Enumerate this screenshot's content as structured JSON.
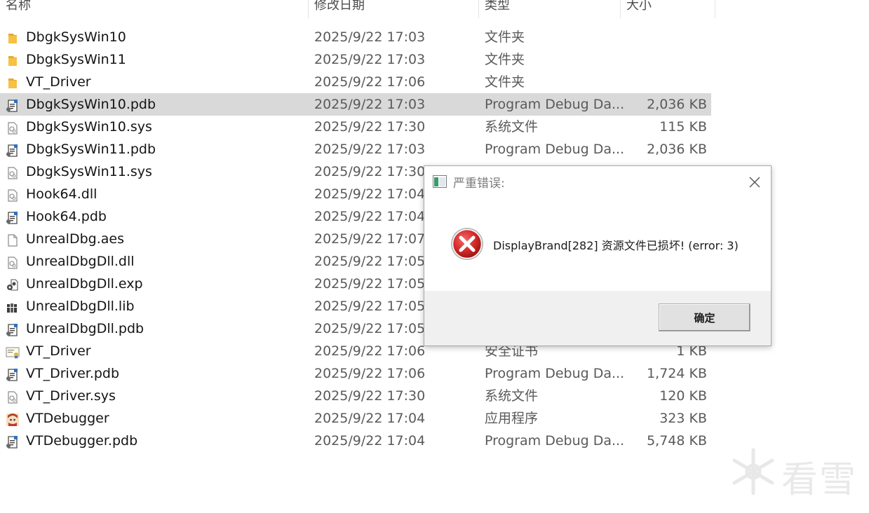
{
  "columns": {
    "name": "名称",
    "date": "修改日期",
    "type": "类型",
    "size": "大小"
  },
  "files": [
    {
      "name": "DbgkSysWin10",
      "date": "2025/9/22 17:03",
      "type": "文件夹",
      "size": "",
      "icon": "folder-icon",
      "selected": false
    },
    {
      "name": "DbgkSysWin11",
      "date": "2025/9/22 17:03",
      "type": "文件夹",
      "size": "",
      "icon": "folder-icon",
      "selected": false
    },
    {
      "name": "VT_Driver",
      "date": "2025/9/22 17:06",
      "type": "文件夹",
      "size": "",
      "icon": "folder-icon",
      "selected": false
    },
    {
      "name": "DbgkSysWin10.pdb",
      "date": "2025/9/22 17:03",
      "type": "Program Debug Da...",
      "size": "2,036 KB",
      "icon": "pdb-file-icon",
      "selected": true
    },
    {
      "name": "DbgkSysWin10.sys",
      "date": "2025/9/22 17:30",
      "type": "系统文件",
      "size": "115 KB",
      "icon": "system-file-icon",
      "selected": false
    },
    {
      "name": "DbgkSysWin11.pdb",
      "date": "2025/9/22 17:03",
      "type": "Program Debug Da...",
      "size": "2,036 KB",
      "icon": "pdb-file-icon",
      "selected": false
    },
    {
      "name": "DbgkSysWin11.sys",
      "date": "2025/9/22 17:30",
      "type": "",
      "size": "",
      "icon": "system-file-icon",
      "selected": false
    },
    {
      "name": "Hook64.dll",
      "date": "2025/9/22 17:04",
      "type": "",
      "size": "",
      "icon": "system-file-icon",
      "selected": false
    },
    {
      "name": "Hook64.pdb",
      "date": "2025/9/22 17:04",
      "type": "",
      "size": "",
      "icon": "pdb-file-icon",
      "selected": false
    },
    {
      "name": "UnrealDbg.aes",
      "date": "2025/9/22 17:07",
      "type": "",
      "size": "",
      "icon": "blank-file-icon",
      "selected": false
    },
    {
      "name": "UnrealDbgDll.dll",
      "date": "2025/9/22 17:05",
      "type": "",
      "size": "",
      "icon": "system-file-icon",
      "selected": false
    },
    {
      "name": "UnrealDbgDll.exp",
      "date": "2025/9/22 17:05",
      "type": "",
      "size": "",
      "icon": "gear-file-icon",
      "selected": false
    },
    {
      "name": "UnrealDbgDll.lib",
      "date": "2025/9/22 17:05",
      "type": "",
      "size": "",
      "icon": "library-file-icon",
      "selected": false
    },
    {
      "name": "UnrealDbgDll.pdb",
      "date": "2025/9/22 17:05",
      "type": "",
      "size": "",
      "icon": "pdb-file-icon",
      "selected": false
    },
    {
      "name": "VT_Driver",
      "date": "2025/9/22 17:06",
      "type": "安全证书",
      "size": "1 KB",
      "icon": "certificate-icon",
      "selected": false
    },
    {
      "name": "VT_Driver.pdb",
      "date": "2025/9/22 17:06",
      "type": "Program Debug Da...",
      "size": "1,724 KB",
      "icon": "pdb-file-icon",
      "selected": false
    },
    {
      "name": "VT_Driver.sys",
      "date": "2025/9/22 17:30",
      "type": "系统文件",
      "size": "120 KB",
      "icon": "system-file-icon",
      "selected": false
    },
    {
      "name": "VTDebugger",
      "date": "2025/9/22 17:04",
      "type": "应用程序",
      "size": "323 KB",
      "icon": "app-icon",
      "selected": false
    },
    {
      "name": "VTDebugger.pdb",
      "date": "2025/9/22 17:04",
      "type": "Program Debug Da...",
      "size": "5,748 KB",
      "icon": "pdb-file-icon",
      "selected": false
    }
  ],
  "dialog": {
    "title": "严重错误:",
    "message": "DisplayBrand[282] 资源文件已损坏! (error: 3)",
    "ok_label": "确定",
    "icon": "error-icon"
  },
  "watermark": {
    "text": "看雪"
  },
  "colors": {
    "selected_row": "#d9d9d9",
    "error_red": "#d42a2a",
    "folder_yellow": "#f5c242",
    "footer_bg": "#f0f0f0"
  }
}
